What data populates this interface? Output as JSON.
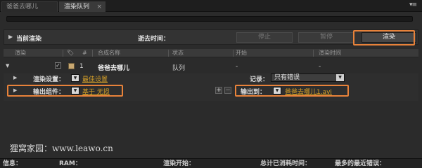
{
  "tabs": [
    {
      "label": "爸爸去哪儿"
    },
    {
      "label": "渲染队列"
    }
  ],
  "tab_close_glyph": "×",
  "panel_menu_glyph": "▾≡",
  "current_render": {
    "label": "当前渲染",
    "elapsed_label": "逝去时间：",
    "stop_label": "停止",
    "pause_label": "暂停",
    "render_label": "渲染"
  },
  "columns": [
    "渲染",
    "#",
    "合成名称",
    "状态",
    "开始",
    "渲染时间"
  ],
  "item": {
    "index": "1",
    "comp_name": "爸爸去哪儿",
    "status": "队列",
    "start": "-",
    "render_time": "-",
    "checked": true
  },
  "settings": {
    "render_settings_label": "渲染设置：",
    "render_settings_value": "最佳设置",
    "log_label": "记录：",
    "log_value": "只有错误",
    "output_module_label": "输出组件：",
    "output_module_value": "基于 无损",
    "output_to_label": "输出到：",
    "output_to_value": "爸爸去哪儿1.avi",
    "add_glyph": "+",
    "remove_glyph": "−"
  },
  "watermark": "狸窝家园：www.leawo.cn",
  "status_bar": {
    "info": "信息：",
    "ram": "RAM：",
    "render_start": "渲染开始：",
    "total_time": "总计已消耗时间：",
    "recent_error": "最多的最近错误："
  },
  "colors": {
    "highlight_box": "#e8823a",
    "link": "#d6a028",
    "label_swatch": "#c9a872"
  }
}
